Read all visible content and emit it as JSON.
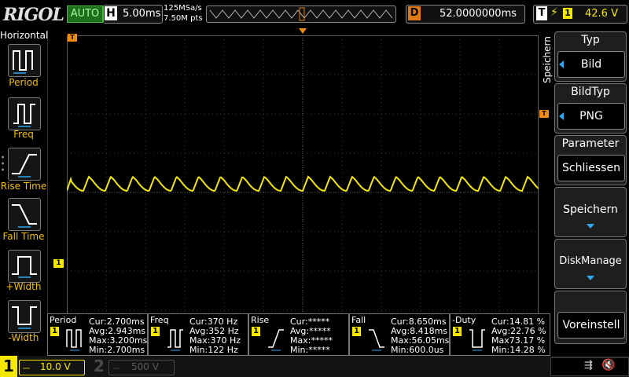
{
  "topbar": {
    "logo": "RIGOL",
    "run_state": "AUTO",
    "timebase_letter": "H",
    "timebase": "5.00ms",
    "sample_rate": "125MSa/s",
    "memory_depth": "7.50M pts",
    "delay_letter": "D",
    "delay": "52.0000000ms",
    "trigger_letter": "T",
    "trigger_channel": "1",
    "trigger_level": "42.6 V"
  },
  "left_panel": {
    "title": "Horizontal",
    "items": [
      {
        "label": "Period"
      },
      {
        "label": "Freq"
      },
      {
        "label": "Rise Time"
      },
      {
        "label": "Fall Time"
      },
      {
        "label": "+Width"
      },
      {
        "label": "-Width"
      }
    ]
  },
  "right_menu": {
    "side_title": "Speichern",
    "buttons": [
      {
        "header": "Typ",
        "value": "Bild"
      },
      {
        "header": "BildTyp",
        "value": "PNG"
      },
      {
        "header": "Parameter",
        "value": "Schliessen"
      },
      {
        "label": "Speichern"
      },
      {
        "label": "DiskManage"
      },
      {
        "label": "Voreinstell"
      }
    ]
  },
  "markers": {
    "trigger_marker": "T",
    "channel_marker": "1"
  },
  "measurements": [
    {
      "name": "Period",
      "badge": "1",
      "cur": "Cur:2.700ms",
      "avg": "Avg:2.943ms",
      "max": "Max:3.200ms",
      "min": "Min:2.700ms"
    },
    {
      "name": "Freq",
      "badge": "1",
      "cur": "Cur:370 Hz",
      "avg": "Avg:352 Hz",
      "max": "Max:370 Hz",
      "min": "Min:122 Hz"
    },
    {
      "name": "Rise",
      "badge": "1",
      "cur": "Cur:*****",
      "avg": "Avg:*****",
      "max": "Max:*****",
      "min": "Min:*****"
    },
    {
      "name": "Fall",
      "badge": "1",
      "cur": "Cur:8.650ms",
      "avg": "Avg:8.418ms",
      "max": "Max:56.05ms",
      "min": "Min:600.0us"
    },
    {
      "name": "-Duty",
      "badge": "1",
      "cur": "Cur:14.81 %",
      "avg": "Avg:22.76 %",
      "max": "Max73.17 %",
      "min": "Min:14.28 %"
    }
  ],
  "bottom": {
    "ch1_number": "1",
    "ch1_scale": "10.0 V",
    "ch2_number": "2",
    "ch2_scale": "500 V"
  },
  "colors": {
    "ch1": "#f5e800",
    "trigger": "#f08a10",
    "accent_blue": "#2aa8f0"
  }
}
